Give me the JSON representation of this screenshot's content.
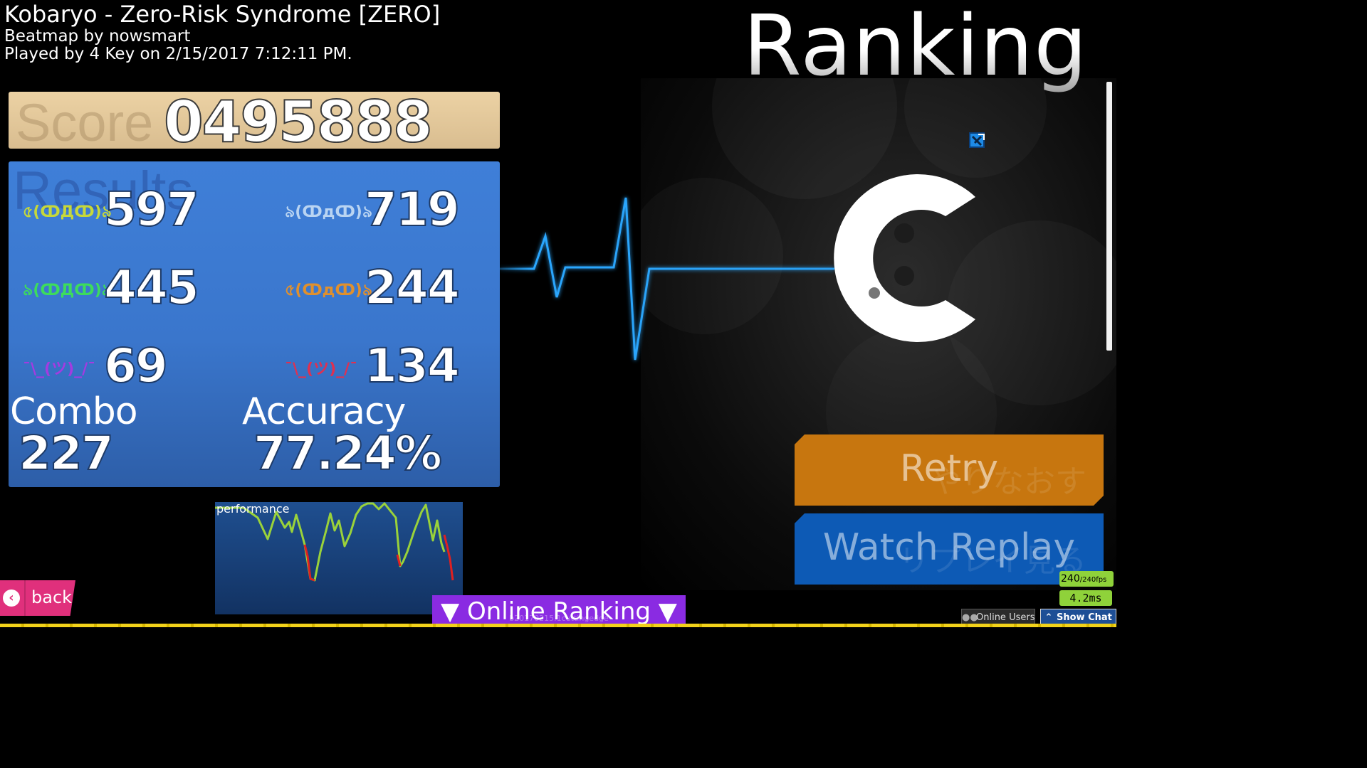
{
  "header": {
    "song_title": "Kobaryo - Zero-Risk Syndrome [ZERO]",
    "beatmap_by": "Beatmap by nowsmart",
    "played_by": "Played by 4 Key on 2/15/2017 7:12:11 PM."
  },
  "ranking": {
    "title": "Ranking",
    "grade": "C"
  },
  "score": {
    "label": "Score",
    "value": "0495888"
  },
  "results": {
    "watermark": "Results",
    "hits": [
      {
        "icon": "৫(ↀДↀ)৯",
        "count": "597",
        "color": "#c6d83a"
      },
      {
        "icon": "৯(ↀдↀ)৯",
        "count": "719",
        "color": "#b9d4f2"
      },
      {
        "icon": "৯(ↀДↀ)৯",
        "count": "445",
        "color": "#3ddc5c"
      },
      {
        "icon": "৫(ↀдↀ)৯",
        "count": "244",
        "color": "#e0902e"
      },
      {
        "icon": "¯\\_(ツ)_/¯",
        "count": "69",
        "color": "#a43be0"
      },
      {
        "icon": "¯\\_(ツ)_/¯",
        "count": "134",
        "color": "#e03050"
      }
    ],
    "combo_label": "Combo",
    "combo_value": "227",
    "accuracy_label": "Accuracy",
    "accuracy_value": "77.24%"
  },
  "performance": {
    "label": "performance"
  },
  "buttons": {
    "retry": "Retry",
    "retry_jp": "やりなおす",
    "watch_replay": "Watch Replay",
    "watch_replay_jp": "リプレイ見る",
    "back": "back",
    "online_ranking": "▼ Online Ranking ▼",
    "online_ranking_sub": "b20170215.1cuttingedge",
    "online_users": "Online Users",
    "show_chat": "Show Chat"
  },
  "status": {
    "fps": "240",
    "fps_max": "/240fps",
    "latency": "4.2ms"
  },
  "colors": {
    "score_bar": "#e6cc9c",
    "results_panel": "#3d7bd4",
    "retry_button": "#c7760f",
    "watch_replay_button": "#0d5ab5",
    "back_button": "#e0307c",
    "online_ranking_button": "#8a2be2",
    "fps_badge": "#8fd23a",
    "heartbeat": "#2aa7ff"
  }
}
